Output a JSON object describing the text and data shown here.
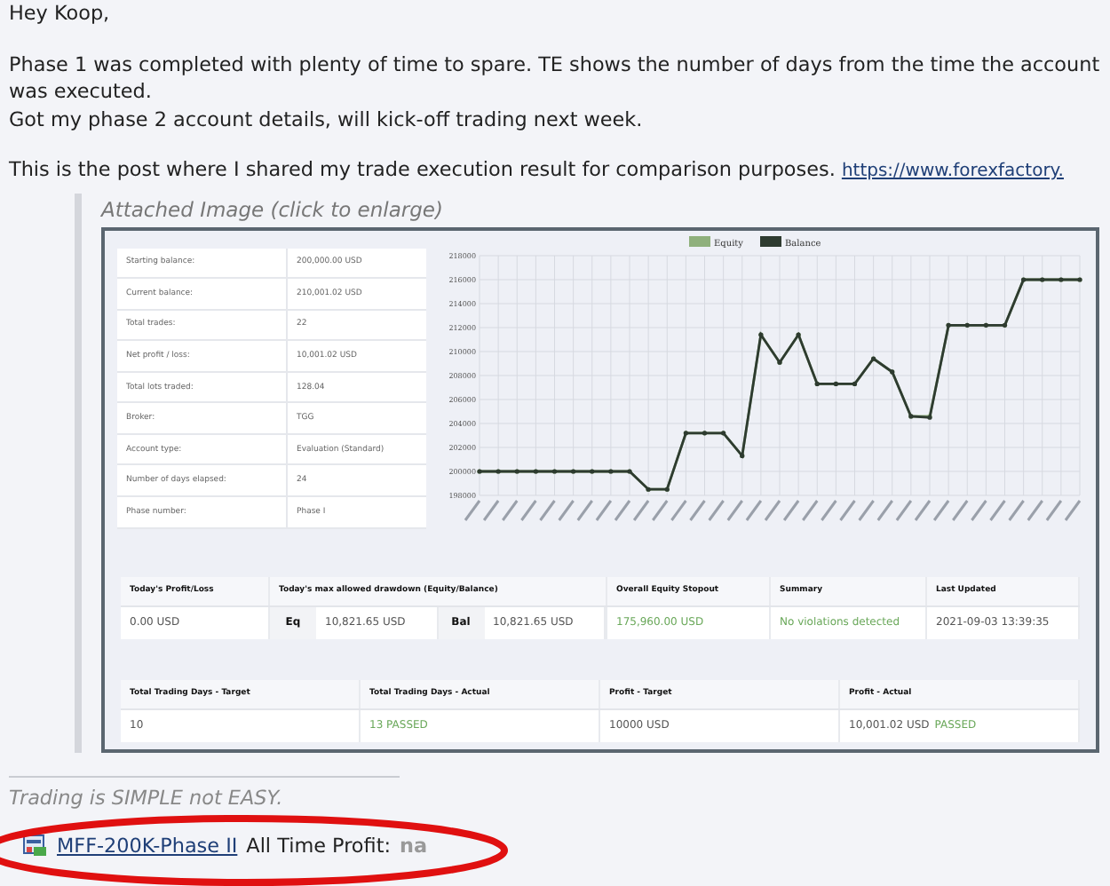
{
  "greeting": "Hey Koop,",
  "paragraph_1": [
    "Phase 1 was completed with plenty of time to spare. TE shows the number of days from the time the account",
    "was executed.",
    "Got my phase 2 account details, will kick-off trading next week."
  ],
  "paragraph_2": {
    "text": "This is the post where I shared my trade execution result for comparison purposes.",
    "link": "https://www.forexfactory."
  },
  "attachment": {
    "caption": "Attached Image (click to enlarge)",
    "stats": [
      {
        "label": "Starting balance:",
        "value": "200,000.00 USD"
      },
      {
        "label": "Current balance:",
        "value": "210,001.02 USD"
      },
      {
        "label": "Total trades:",
        "value": "22"
      },
      {
        "label": "Net profit / loss:",
        "value": "10,001.02 USD"
      },
      {
        "label": "Total lots traded:",
        "value": "128.04"
      },
      {
        "label": "Broker:",
        "value": "TGG"
      },
      {
        "label": "Account type:",
        "value": "Evaluation (Standard)"
      },
      {
        "label": "Number of days elapsed:",
        "value": "24"
      },
      {
        "label": "Phase number:",
        "value": "Phase I"
      }
    ],
    "chart_data": {
      "type": "line",
      "grid": true,
      "legend": "top",
      "ylim": [
        198000,
        218000
      ],
      "yticks": [
        198000,
        200000,
        202000,
        204000,
        206000,
        208000,
        210000,
        212000,
        214000,
        216000,
        218000
      ],
      "series": [
        {
          "name": "Equity",
          "color": "#8fb07c",
          "values": [
            200000,
            200000,
            200000,
            200000,
            200000,
            200000,
            200000,
            200000,
            200000,
            198500,
            198500,
            203200,
            203200,
            203200,
            201300,
            211400,
            209100,
            211400,
            207300,
            207300,
            207300,
            209400,
            208300,
            204600,
            204600,
            212200,
            212200,
            212200,
            212200,
            216000,
            216000,
            216000,
            216000
          ]
        },
        {
          "name": "Balance",
          "color": "#2e3b30",
          "values": [
            200000,
            200000,
            200000,
            200000,
            200000,
            200000,
            200000,
            200000,
            200000,
            198500,
            198500,
            203200,
            203200,
            203200,
            201300,
            211400,
            209100,
            211400,
            207300,
            207300,
            207300,
            209400,
            208300,
            204600,
            204500,
            212200,
            212200,
            212200,
            212200,
            216000,
            216000,
            216000,
            216000
          ]
        }
      ]
    },
    "drawdown_table": {
      "headers": [
        "Today's Profit/Loss",
        "Today's max allowed drawdown (Equity/Balance)",
        "Overall Equity Stopout",
        "Summary",
        "Last Updated"
      ],
      "profit_loss": "0.00 USD",
      "eq_label": "Eq",
      "eq_value": "10,821.65 USD",
      "bal_label": "Bal",
      "bal_value": "10,821.65 USD",
      "stopout": {
        "text": "175,960.00 USD",
        "color": "#6aa85a"
      },
      "summary": {
        "text": "No violations detected",
        "color": "#6aa85a"
      },
      "last_updated": "2021-09-03 13:39:35"
    },
    "targets_table": {
      "headers": [
        "Total Trading Days - Target",
        "Total Trading Days - Actual",
        "Profit - Target",
        "Profit - Actual"
      ],
      "cells": [
        {
          "text": "10"
        },
        {
          "text": "13 PASSED",
          "color": "#6aa85a"
        },
        {
          "text": "10000 USD"
        },
        {
          "text": "10,001.02 USD",
          "tail": {
            "text": "PASSED",
            "color": "#6aa85a"
          }
        }
      ]
    }
  },
  "signature": "Trading is SIMPLE not EASY.",
  "footer": {
    "link": "MFF-200K-Phase II",
    "label": "All Time Profit:",
    "value": "na"
  }
}
